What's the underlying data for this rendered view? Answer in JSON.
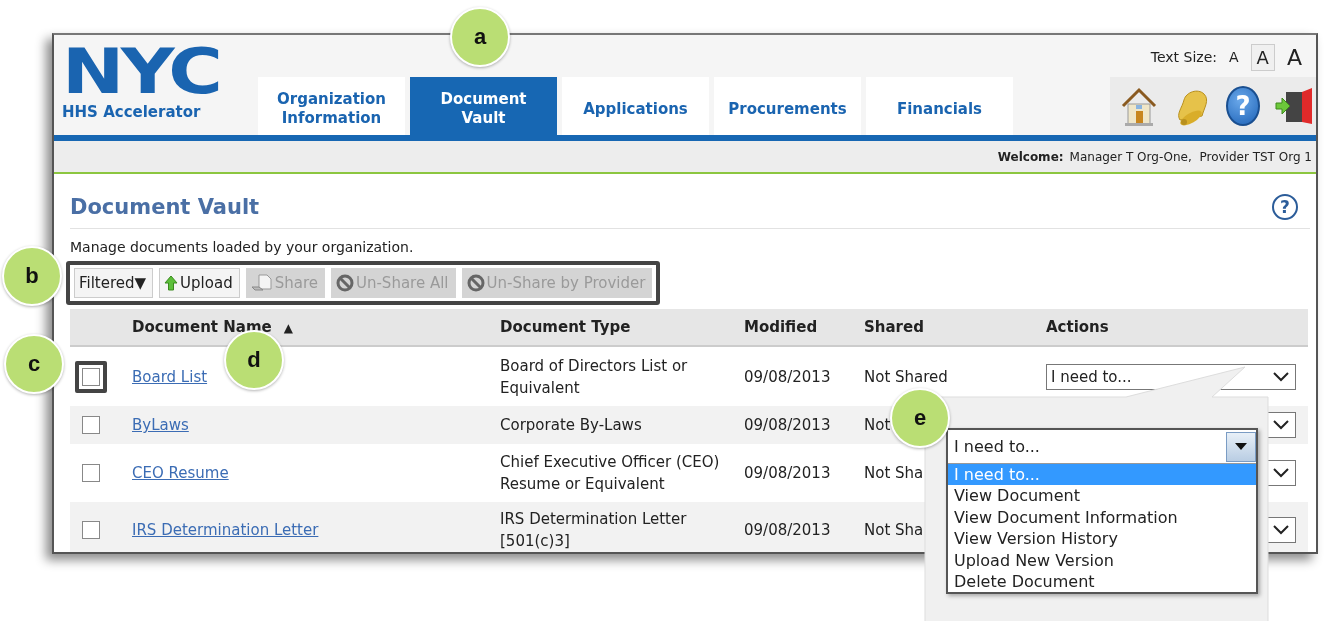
{
  "logo": {
    "mark": "NYC",
    "subtitle": "HHS Accelerator"
  },
  "text_size": {
    "label": "Text Size:",
    "options": [
      {
        "label": "A",
        "selected": false
      },
      {
        "label": "A",
        "selected": true
      },
      {
        "label": "A",
        "selected": false
      }
    ]
  },
  "tabs": [
    {
      "label": "Organization Information",
      "selected": false
    },
    {
      "label": "Document Vault",
      "selected": true
    },
    {
      "label": "Applications",
      "selected": false
    },
    {
      "label": "Procurements",
      "selected": false
    },
    {
      "label": "Financials",
      "selected": false
    }
  ],
  "header_icons": [
    {
      "kind": "home"
    },
    {
      "kind": "bell"
    },
    {
      "kind": "help",
      "label": "?"
    },
    {
      "kind": "exit"
    }
  ],
  "welcome": {
    "label": "Welcome:",
    "user": "Manager T Org-One,  Provider TST Org 1"
  },
  "page": {
    "title": "Document Vault",
    "help_label": "?",
    "description": "Manage documents loaded by your organization."
  },
  "toolbar": {
    "highlighted": true,
    "buttons": [
      {
        "kind": "menu",
        "label": "Filtered▼",
        "disabled": false
      },
      {
        "kind": "upload",
        "label": "Upload",
        "disabled": false
      },
      {
        "kind": "share",
        "label": "Share",
        "disabled": true
      },
      {
        "kind": "unshare",
        "label": "Un-Share All",
        "disabled": true
      },
      {
        "kind": "unshare",
        "label": "Un-Share by Provider",
        "disabled": true
      }
    ]
  },
  "table": {
    "columns": [
      {
        "label": "Document Name",
        "sort_indicator": "▲"
      },
      {
        "label": "Document Type"
      },
      {
        "label": "Modified"
      },
      {
        "label": "Shared"
      },
      {
        "label": "Actions"
      }
    ],
    "rows": [
      {
        "checked": false,
        "highlighted": true,
        "name": "Board List",
        "type": "Board of Directors List or Equivalent",
        "modified": "09/08/2013",
        "shared": "Not Shared",
        "action": "I need to..."
      },
      {
        "checked": false,
        "highlighted": false,
        "name": "ByLaws",
        "type": "Corporate By-Laws",
        "modified": "09/08/2013",
        "shared": "Not"
      },
      {
        "checked": false,
        "highlighted": false,
        "name": "CEO Resume",
        "type": "Chief Executive Officer (CEO) Resume or Equivalent",
        "modified": "09/08/2013",
        "shared": "Not Sha"
      },
      {
        "checked": false,
        "highlighted": false,
        "name": "IRS Determination Letter",
        "type": "IRS Determination Letter [501(c)3]",
        "modified": "09/08/2013",
        "shared": "Not Sha"
      }
    ]
  },
  "callouts": [
    {
      "label": "a"
    },
    {
      "label": "b"
    },
    {
      "label": "c"
    },
    {
      "label": "d"
    },
    {
      "label": "e"
    }
  ],
  "action_popup": {
    "value": "I need to...",
    "options": [
      {
        "label": "I need to...",
        "selected": true
      },
      {
        "label": "View Document",
        "selected": false
      },
      {
        "label": "View Document Information",
        "selected": false
      },
      {
        "label": "View Version History",
        "selected": false
      },
      {
        "label": "Upload New Version",
        "selected": false
      },
      {
        "label": "Delete Document",
        "selected": false
      }
    ]
  }
}
